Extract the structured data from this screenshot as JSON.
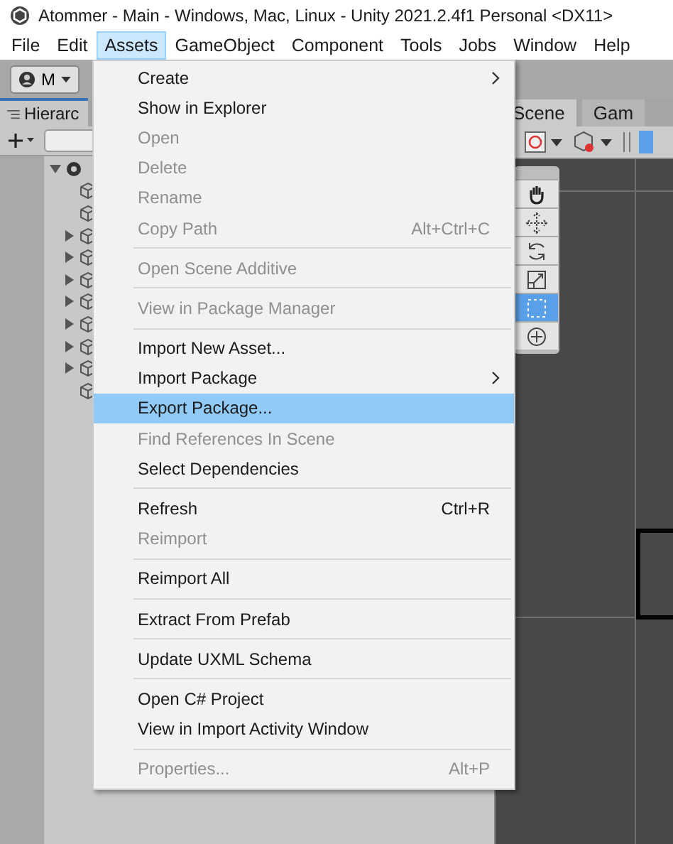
{
  "window": {
    "title": "Atommer - Main - Windows, Mac, Linux - Unity 2021.2.4f1 Personal <DX11>"
  },
  "menu_bar": [
    {
      "label": "File",
      "selected": false
    },
    {
      "label": "Edit",
      "selected": false
    },
    {
      "label": "Assets",
      "selected": true
    },
    {
      "label": "GameObject",
      "selected": false
    },
    {
      "label": "Component",
      "selected": false
    },
    {
      "label": "Tools",
      "selected": false
    },
    {
      "label": "Jobs",
      "selected": false
    },
    {
      "label": "Window",
      "selected": false
    },
    {
      "label": "Help",
      "selected": false
    }
  ],
  "toolbar": {
    "account_button": "M"
  },
  "hierarchy": {
    "tab": "Hierarc",
    "root_expanded": true,
    "rows": [
      {
        "expandable": false
      },
      {
        "expandable": false
      },
      {
        "expandable": true
      },
      {
        "expandable": true
      },
      {
        "expandable": true
      },
      {
        "expandable": true
      },
      {
        "expandable": true
      },
      {
        "expandable": true
      },
      {
        "expandable": true
      },
      {
        "expandable": false
      }
    ]
  },
  "scene": {
    "tabs": [
      {
        "label": "Scene",
        "selected": true
      },
      {
        "label": "Gam",
        "selected": false
      }
    ],
    "tools": [
      {
        "selected": false
      },
      {
        "selected": false
      },
      {
        "selected": false
      },
      {
        "selected": false
      },
      {
        "selected": true
      },
      {
        "selected": false
      }
    ]
  },
  "assets_menu": [
    {
      "kind": "item",
      "label": "Create",
      "disabled": false,
      "selected": false,
      "submenu": true
    },
    {
      "kind": "item",
      "label": "Show in Explorer",
      "disabled": false,
      "selected": false
    },
    {
      "kind": "item",
      "label": "Open",
      "disabled": true,
      "selected": false
    },
    {
      "kind": "item",
      "label": "Delete",
      "disabled": true,
      "selected": false
    },
    {
      "kind": "item",
      "label": "Rename",
      "disabled": true,
      "selected": false
    },
    {
      "kind": "item",
      "label": "Copy Path",
      "disabled": true,
      "selected": false,
      "shortcut": "Alt+Ctrl+C"
    },
    {
      "kind": "separator"
    },
    {
      "kind": "item",
      "label": "Open Scene Additive",
      "disabled": true,
      "selected": false
    },
    {
      "kind": "separator"
    },
    {
      "kind": "item",
      "label": "View in Package Manager",
      "disabled": true,
      "selected": false
    },
    {
      "kind": "separator"
    },
    {
      "kind": "item",
      "label": "Import New Asset...",
      "disabled": false,
      "selected": false
    },
    {
      "kind": "item",
      "label": "Import Package",
      "disabled": false,
      "selected": false,
      "submenu": true
    },
    {
      "kind": "item",
      "label": "Export Package...",
      "disabled": false,
      "selected": true
    },
    {
      "kind": "item",
      "label": "Find References In Scene",
      "disabled": true,
      "selected": false
    },
    {
      "kind": "item",
      "label": "Select Dependencies",
      "disabled": false,
      "selected": false
    },
    {
      "kind": "separator"
    },
    {
      "kind": "item",
      "label": "Refresh",
      "disabled": false,
      "selected": false,
      "shortcut": "Ctrl+R"
    },
    {
      "kind": "item",
      "label": "Reimport",
      "disabled": true,
      "selected": false
    },
    {
      "kind": "separator"
    },
    {
      "kind": "item",
      "label": "Reimport All",
      "disabled": false,
      "selected": false
    },
    {
      "kind": "separator"
    },
    {
      "kind": "item",
      "label": "Extract From Prefab",
      "disabled": false,
      "selected": false
    },
    {
      "kind": "separator"
    },
    {
      "kind": "item",
      "label": "Update UXML Schema",
      "disabled": false,
      "selected": false
    },
    {
      "kind": "separator"
    },
    {
      "kind": "item",
      "label": "Open C# Project",
      "disabled": false,
      "selected": false
    },
    {
      "kind": "item",
      "label": "View in Import Activity Window",
      "disabled": false,
      "selected": false
    },
    {
      "kind": "separator"
    },
    {
      "kind": "item",
      "label": "Properties...",
      "disabled": true,
      "selected": false,
      "shortcut": "Alt+P"
    }
  ]
}
